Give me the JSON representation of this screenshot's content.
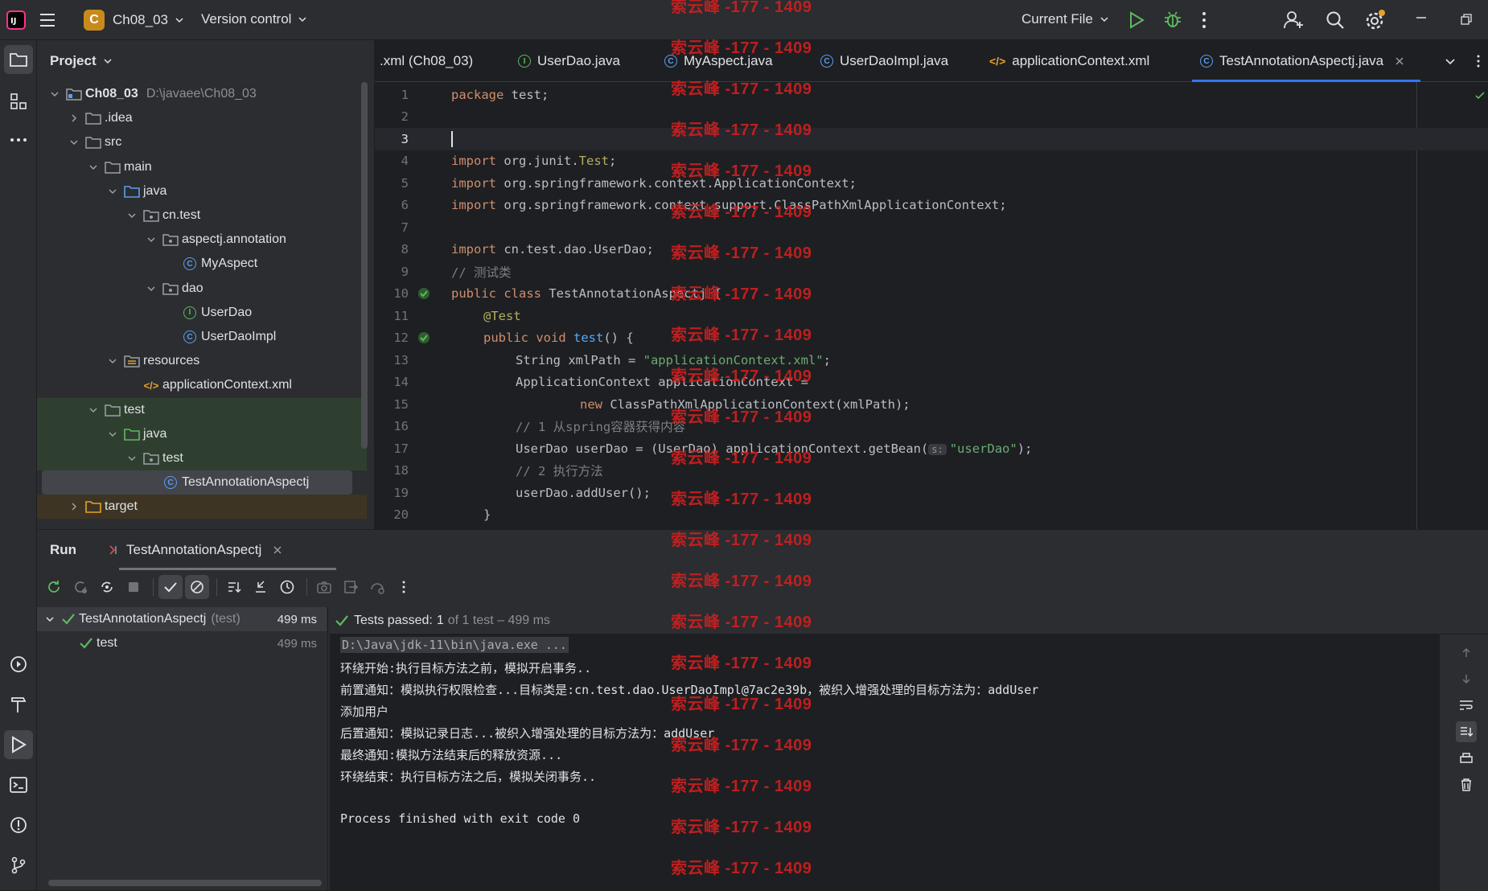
{
  "titlebar": {
    "project_initial": "C",
    "project_name": "Ch08_03",
    "vcs": "Version control",
    "run_config": "Current File"
  },
  "project_panel": {
    "title": "Project",
    "tree": [
      {
        "label": "Ch08_03",
        "hint": "D:\\javaee\\Ch08_03",
        "icon": "module-folder-icon",
        "expanded": true
      },
      {
        "label": ".idea",
        "icon": "folder-icon",
        "expanded": false
      },
      {
        "label": "src",
        "icon": "folder-icon",
        "expanded": true
      },
      {
        "label": "main",
        "icon": "folder-icon",
        "expanded": true
      },
      {
        "label": "java",
        "icon": "source-folder-icon",
        "expanded": true
      },
      {
        "label": "cn.test",
        "icon": "package-icon",
        "expanded": true
      },
      {
        "label": "aspectj.annotation",
        "icon": "package-icon",
        "expanded": true
      },
      {
        "label": "MyAspect",
        "icon": "class-icon"
      },
      {
        "label": "dao",
        "icon": "package-icon",
        "expanded": true
      },
      {
        "label": "UserDao",
        "icon": "interface-icon"
      },
      {
        "label": "UserDaoImpl",
        "icon": "class-icon"
      },
      {
        "label": "resources",
        "icon": "resources-folder-icon",
        "expanded": true
      },
      {
        "label": "applicationContext.xml",
        "icon": "xml-icon"
      },
      {
        "label": "test",
        "icon": "folder-icon",
        "expanded": true
      },
      {
        "label": "java",
        "icon": "test-source-folder-icon",
        "expanded": true
      },
      {
        "label": "test",
        "icon": "package-icon",
        "expanded": true
      },
      {
        "label": "TestAnnotationAspectj",
        "icon": "class-icon",
        "selected": true
      },
      {
        "label": "target",
        "icon": "excluded-folder-icon",
        "expanded": false
      }
    ]
  },
  "editor": {
    "tabs": [
      {
        "label": ".xml (Ch08_03)",
        "icon": ""
      },
      {
        "label": "UserDao.java",
        "icon": "interface-icon"
      },
      {
        "label": "MyAspect.java",
        "icon": "class-icon"
      },
      {
        "label": "UserDaoImpl.java",
        "icon": "class-icon"
      },
      {
        "label": "applicationContext.xml",
        "icon": "xml-icon"
      },
      {
        "label": "TestAnnotationAspectj.java",
        "icon": "class-icon",
        "active": true
      }
    ],
    "line_numbers": [
      "1",
      "2",
      "3",
      "4",
      "5",
      "6",
      "7",
      "8",
      "9",
      "10",
      "11",
      "12",
      "13",
      "14",
      "15",
      "16",
      "17",
      "18",
      "19",
      "20"
    ],
    "code": {
      "l1_kw": "package",
      "l1_rest": " test;",
      "l4_kw": "import",
      "l4_a": " org.junit.",
      "l4_ann": "Test",
      "l4_b": ";",
      "l5_kw": "import",
      "l5_rest": " org.springframework.context.ApplicationContext;",
      "l6_kw": "import",
      "l6_rest": " org.springframework.context.support.ClassPathXmlApplicationContext;",
      "l8_kw": "import",
      "l8_rest": " cn.test.dao.UserDao;",
      "l9": "// 测试类",
      "l10_kw": "public class",
      "l10_rest": " TestAnnotationAspectj {",
      "l11": "@Test",
      "l12_kw": "public void",
      "l12_fn": " test",
      "l12_rest": "() {",
      "l13_a": "String xmlPath = ",
      "l13_str": "\"applicationContext.xml\"",
      "l13_b": ";",
      "l14": "ApplicationContext applicationContext =",
      "l15_kw": "new",
      "l15_rest": " ClassPathXmlApplicationContext(xmlPath);",
      "l16": "// 1 从spring容器获得内容",
      "l17_a": "UserDao userDao = (UserDao) applicationContext.getBean(",
      "l17_hint": "s:",
      "l17_str": "\"userDao\"",
      "l17_b": ");",
      "l18": "// 2 执行方法",
      "l19": "userDao.addUser();",
      "l20": "}"
    }
  },
  "run_panel": {
    "title": "Run",
    "tab_label": "TestAnnotationAspectj",
    "tests": [
      {
        "name": "TestAnnotationAspectj",
        "suffix": "(test)",
        "time": "499 ms"
      },
      {
        "name": "test",
        "time": "499 ms"
      }
    ],
    "status_strong": "Tests passed:",
    "status_count": "1",
    "status_rest": "of 1 test – 499 ms",
    "console": [
      "D:\\Java\\jdk-11\\bin\\java.exe ...",
      "环绕开始:执行目标方法之前，模拟开启事务..",
      "前置通知：模拟执行权限检查...目标类是:cn.test.dao.UserDaoImpl@7ac2e39b，被织入增强处理的目标方法为：addUser",
      "添加用户",
      "后置通知：模拟记录日志...被织入增强处理的目标方法为：addUser",
      "最终通知:模拟方法结束后的释放资源...",
      "环绕结束：执行目标方法之后，模拟关闭事务..",
      "",
      "Process finished with exit code 0"
    ]
  },
  "watermark": "索云峰 -177 - 1409",
  "colors": {
    "accent": "#3574f0",
    "success": "#5fb85f",
    "watermark": "#cc1f1f"
  }
}
